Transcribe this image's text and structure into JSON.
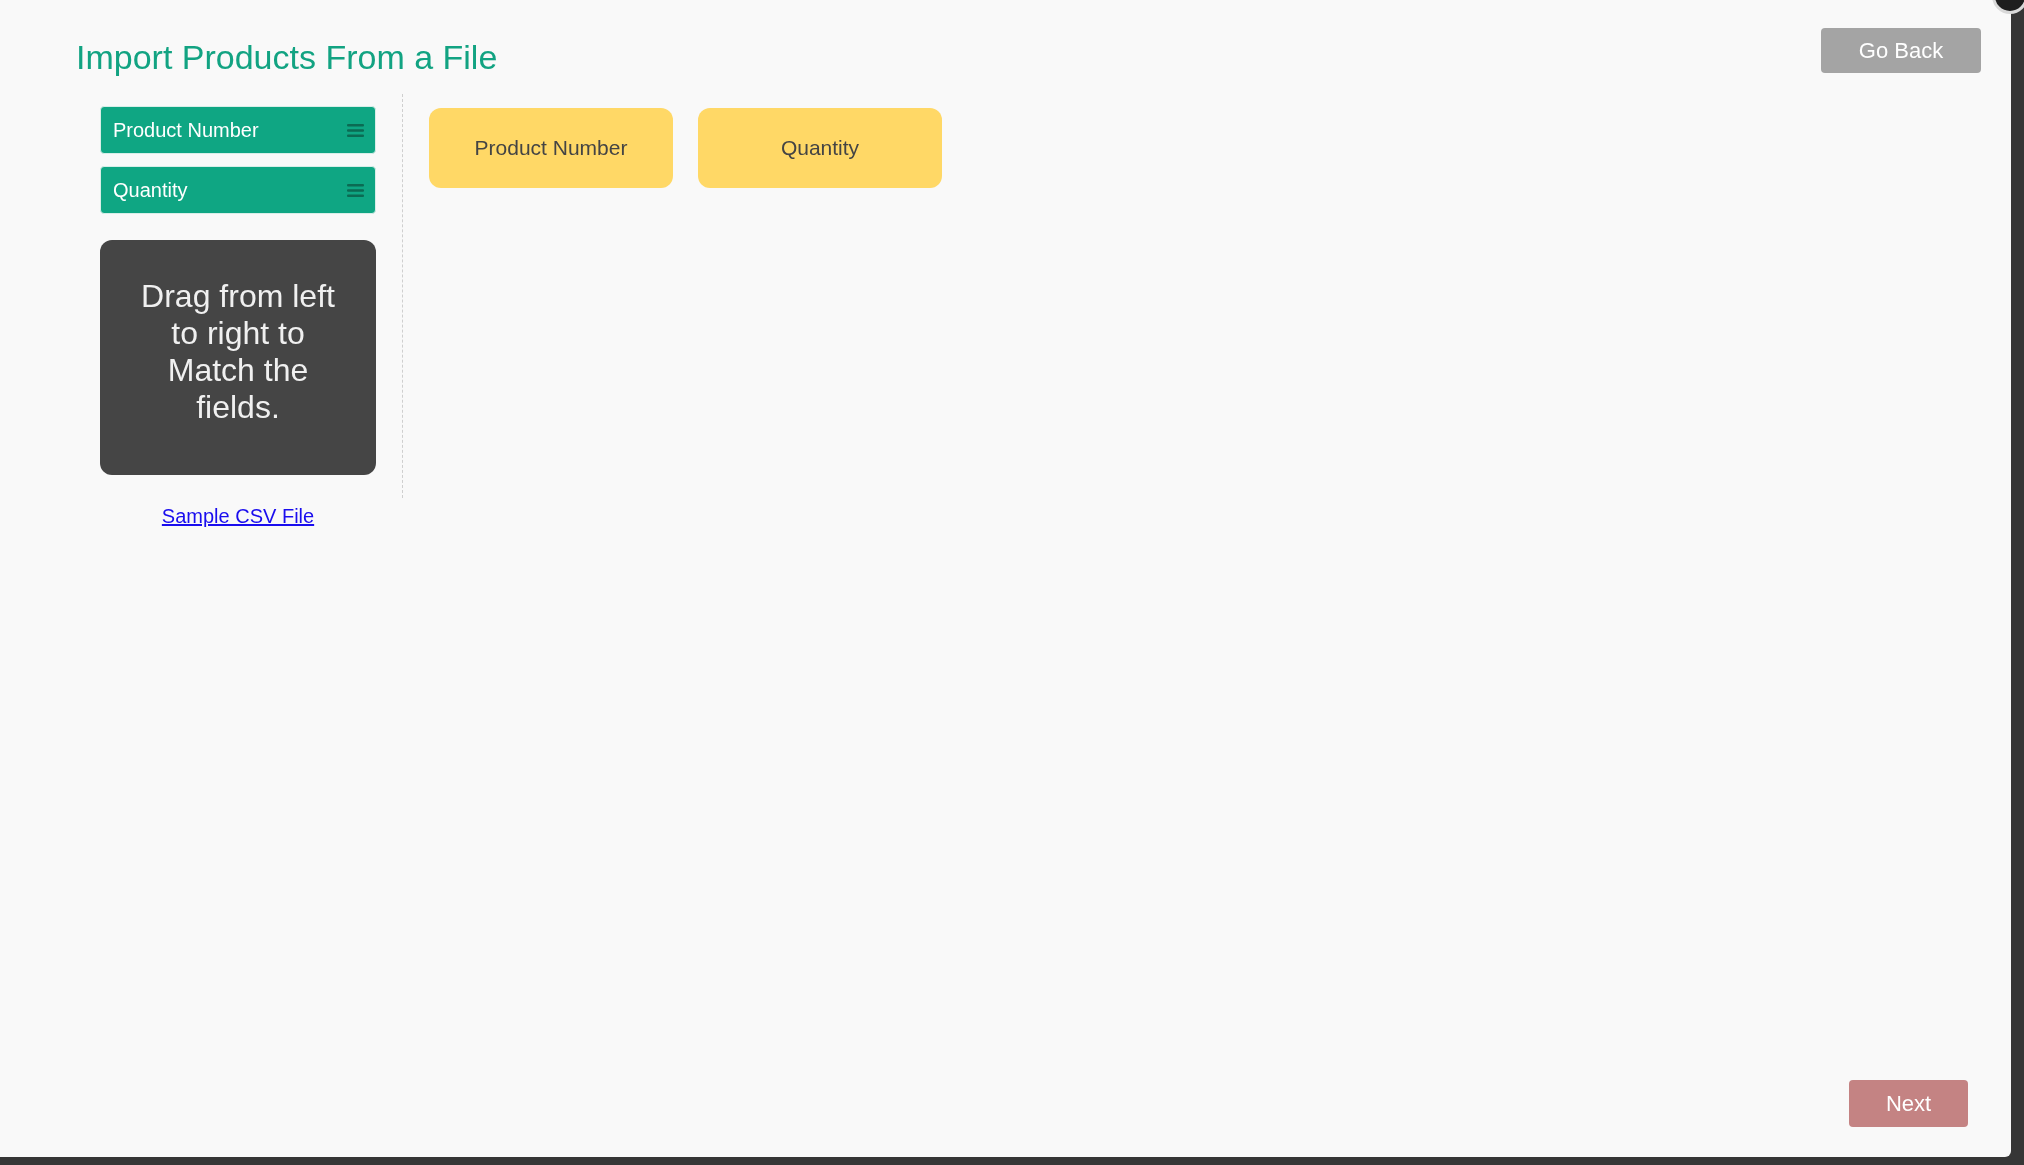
{
  "title": "Import Products From a File",
  "go_back_button": "Go Back",
  "source_fields": [
    {
      "label": "Product Number"
    },
    {
      "label": "Quantity"
    }
  ],
  "instruction": "Drag from left to right to Match the fields.",
  "sample_link": "Sample CSV File",
  "target_fields": [
    {
      "label": "Product Number"
    },
    {
      "label": "Quantity"
    }
  ],
  "next_button": "Next"
}
